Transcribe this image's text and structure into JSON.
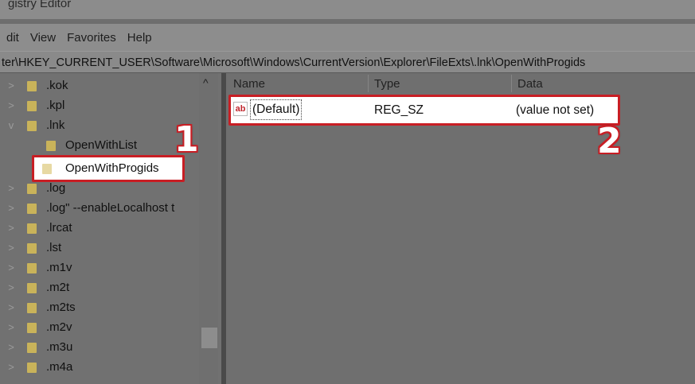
{
  "window": {
    "title": "gistry Editor"
  },
  "menu": [
    "dit",
    "View",
    "Favorites",
    "Help"
  ],
  "address": "ter\\HKEY_CURRENT_USER\\Software\\Microsoft\\Windows\\CurrentVersion\\Explorer\\FileExts\\.lnk\\OpenWithProgids",
  "tree": {
    "items": [
      {
        "label": ".kok",
        "chevron": ">"
      },
      {
        "label": ".kpl",
        "chevron": ">"
      },
      {
        "label": ".lnk",
        "chevron": "v"
      },
      {
        "label": "OpenWithList",
        "chevron": ""
      },
      {
        "label": "OpenWithProgids",
        "chevron": "",
        "selected": true
      },
      {
        "label": ".log",
        "chevron": ">"
      },
      {
        "label": ".log\" --enableLocalhost t",
        "chevron": ">"
      },
      {
        "label": ".lrcat",
        "chevron": ">"
      },
      {
        "label": ".lst",
        "chevron": ">"
      },
      {
        "label": ".m1v",
        "chevron": ">"
      },
      {
        "label": ".m2t",
        "chevron": ">"
      },
      {
        "label": ".m2ts",
        "chevron": ">"
      },
      {
        "label": ".m2v",
        "chevron": ">"
      },
      {
        "label": ".m3u",
        "chevron": ">"
      },
      {
        "label": ".m4a",
        "chevron": ">"
      }
    ],
    "scroll_up": "^"
  },
  "values": {
    "columns": [
      "Name",
      "Type",
      "Data"
    ],
    "rows": [
      {
        "icon": "ab",
        "name": "(Default)",
        "type": "REG_SZ",
        "data": "(value not set)"
      }
    ]
  },
  "callouts": [
    "1",
    "2"
  ],
  "colors": {
    "highlight_border": "#c81e24"
  }
}
